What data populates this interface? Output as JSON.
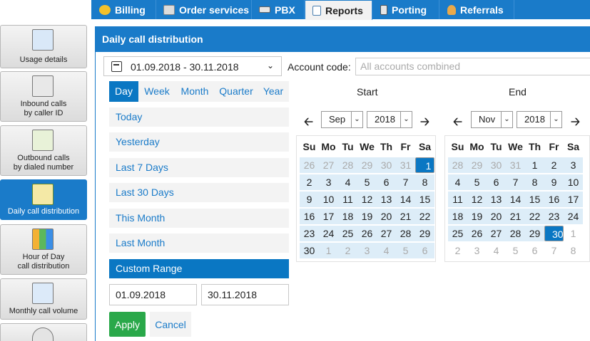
{
  "top_tabs": [
    {
      "label": "Billing",
      "icon": "coins-icon"
    },
    {
      "label": "Order services",
      "icon": "cart-icon"
    },
    {
      "label": "PBX",
      "icon": "pbx-icon"
    },
    {
      "label": "Reports",
      "icon": "report-icon"
    },
    {
      "label": "Porting",
      "icon": "phone-icon"
    },
    {
      "label": "Referrals",
      "icon": "person-icon"
    }
  ],
  "sidebar": {
    "items": [
      {
        "label1": "Usage details",
        "label2": ""
      },
      {
        "label1": "Inbound calls",
        "label2": "by caller ID"
      },
      {
        "label1": "Outbound calls",
        "label2": "by dialed number"
      },
      {
        "label1": "Daily call distribution",
        "label2": ""
      },
      {
        "label1": "Hour of Day",
        "label2": "call distribution"
      },
      {
        "label1": "Monthly call volume",
        "label2": ""
      }
    ]
  },
  "panel": {
    "title": "Daily call distribution",
    "date_range_value": "01.09.2018 - 30.11.2018",
    "account_label": "Account code:",
    "account_placeholder": "All accounts combined"
  },
  "picker": {
    "granularity": [
      "Day",
      "Week",
      "Month",
      "Quarter",
      "Year"
    ],
    "presets": [
      "Today",
      "Yesterday",
      "Last 7 Days",
      "Last 30 Days",
      "This Month",
      "Last Month",
      "Custom Range"
    ],
    "start_input": "01.09.2018",
    "end_input": "30.11.2018",
    "apply_label": "Apply",
    "cancel_label": "Cancel"
  },
  "calendars": {
    "start": {
      "header": "Start",
      "month": "Sep",
      "year": "2018"
    },
    "end": {
      "header": "End",
      "month": "Nov",
      "year": "2018"
    },
    "weekdays": [
      "Su",
      "Mo",
      "Tu",
      "We",
      "Th",
      "Fr",
      "Sa"
    ],
    "start_days": [
      "26",
      "27",
      "28",
      "29",
      "30",
      "31",
      "1",
      "2",
      "3",
      "4",
      "5",
      "6",
      "7",
      "8",
      "9",
      "10",
      "11",
      "12",
      "13",
      "14",
      "15",
      "16",
      "17",
      "18",
      "19",
      "20",
      "21",
      "22",
      "23",
      "24",
      "25",
      "26",
      "27",
      "28",
      "29",
      "30",
      "1",
      "2",
      "3",
      "4",
      "5",
      "6"
    ],
    "end_days": [
      "28",
      "29",
      "30",
      "31",
      "1",
      "2",
      "3",
      "4",
      "5",
      "6",
      "7",
      "8",
      "9",
      "10",
      "11",
      "12",
      "13",
      "14",
      "15",
      "16",
      "17",
      "18",
      "19",
      "20",
      "21",
      "22",
      "23",
      "24",
      "25",
      "26",
      "27",
      "28",
      "29",
      "30",
      "1",
      "2",
      "3",
      "4",
      "5",
      "6",
      "7",
      "8"
    ]
  },
  "colors": {
    "brand": "#1a7bc9",
    "selected": "#0a77c3",
    "range_fill": "#ddedf8",
    "apply": "#2aa84a"
  }
}
